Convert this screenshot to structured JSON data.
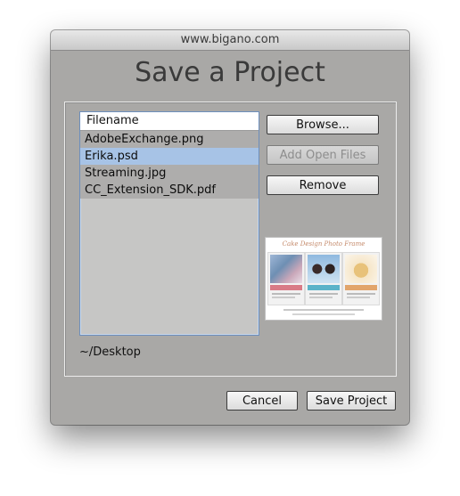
{
  "window": {
    "title": "www.bigano.com",
    "heading": "Save a Project"
  },
  "file_list": {
    "header": "Filename",
    "rows": [
      {
        "label": "AdobeExchange.png",
        "selected": false
      },
      {
        "label": "Erika.psd",
        "selected": true
      },
      {
        "label": "Streaming.jpg",
        "selected": false
      },
      {
        "label": "CC_Extension_SDK.pdf",
        "selected": false
      }
    ]
  },
  "buttons": {
    "browse": "Browse...",
    "add_open_files": "Add Open Files",
    "remove": "Remove",
    "cancel": "Cancel",
    "save_project": "Save Project"
  },
  "preview": {
    "icon": "image-preview-thumbnail",
    "title_text": "Cake Design Photo Frame"
  },
  "path": "~/Desktop",
  "colors": {
    "window_bg": "#a9a8a6",
    "selection": "#a7c3e6",
    "list_bg": "#c6c6c5"
  }
}
